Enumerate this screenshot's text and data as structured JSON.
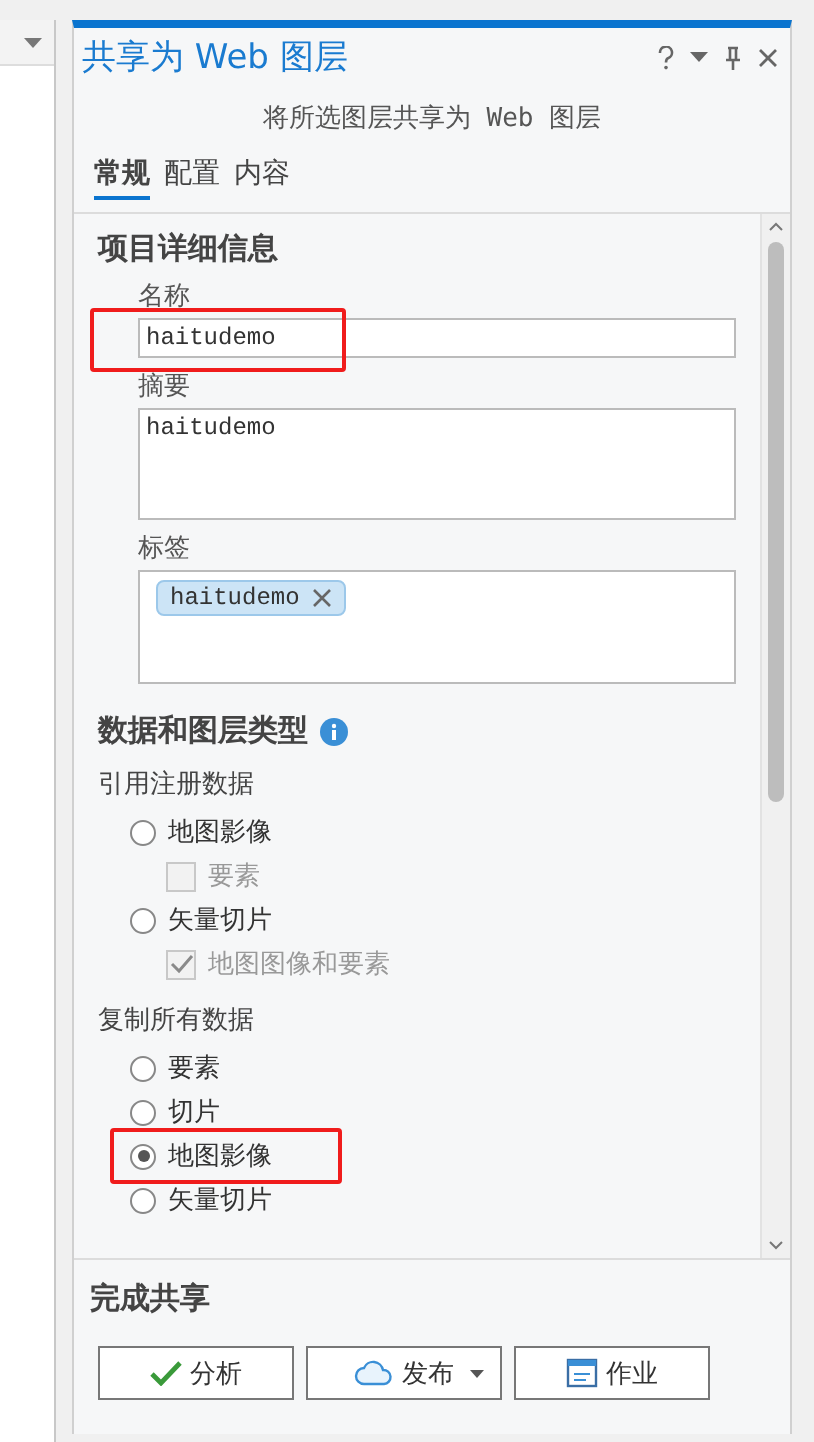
{
  "window": {
    "title": "共享为 Web 图层",
    "subtitle": "将所选图层共享为 Web 图层"
  },
  "tabs": [
    {
      "label": "常规",
      "selected": true
    },
    {
      "label": "配置",
      "selected": false
    },
    {
      "label": "内容",
      "selected": false
    }
  ],
  "details": {
    "heading": "项目详细信息",
    "fields": [
      {
        "kind": "input",
        "label": "名称",
        "value": "haitudemo",
        "highlighted": true
      },
      {
        "kind": "textarea",
        "label": "摘要",
        "value": "haitudemo",
        "highlighted": false
      },
      {
        "kind": "tags",
        "label": "标签",
        "tags": [
          "haitudemo"
        ],
        "highlighted": false
      }
    ]
  },
  "data_types": {
    "heading": "数据和图层类型",
    "groups": [
      {
        "label": "引用注册数据",
        "options": [
          {
            "kind": "radio",
            "label": "地图影像",
            "selected": false,
            "highlighted": false
          },
          {
            "kind": "checkbox",
            "label": "要素",
            "checked": false,
            "disabled": true
          },
          {
            "kind": "radio",
            "label": "矢量切片",
            "selected": false,
            "highlighted": false
          },
          {
            "kind": "checkbox",
            "label": "地图图像和要素",
            "checked": true,
            "disabled": true
          }
        ]
      },
      {
        "label": "复制所有数据",
        "options": [
          {
            "kind": "radio",
            "label": "要素",
            "selected": false,
            "highlighted": false
          },
          {
            "kind": "radio",
            "label": "切片",
            "selected": false,
            "highlighted": false
          },
          {
            "kind": "radio",
            "label": "地图影像",
            "selected": true,
            "highlighted": true
          },
          {
            "kind": "radio",
            "label": "矢量切片",
            "selected": false,
            "highlighted": false
          }
        ]
      }
    ]
  },
  "finish": {
    "heading": "完成共享",
    "buttons": [
      {
        "kind": "check",
        "label": "分析",
        "dropdown": false
      },
      {
        "kind": "cloud",
        "label": "发布",
        "dropdown": true
      },
      {
        "kind": "jobs",
        "label": "作业",
        "dropdown": false
      }
    ]
  }
}
